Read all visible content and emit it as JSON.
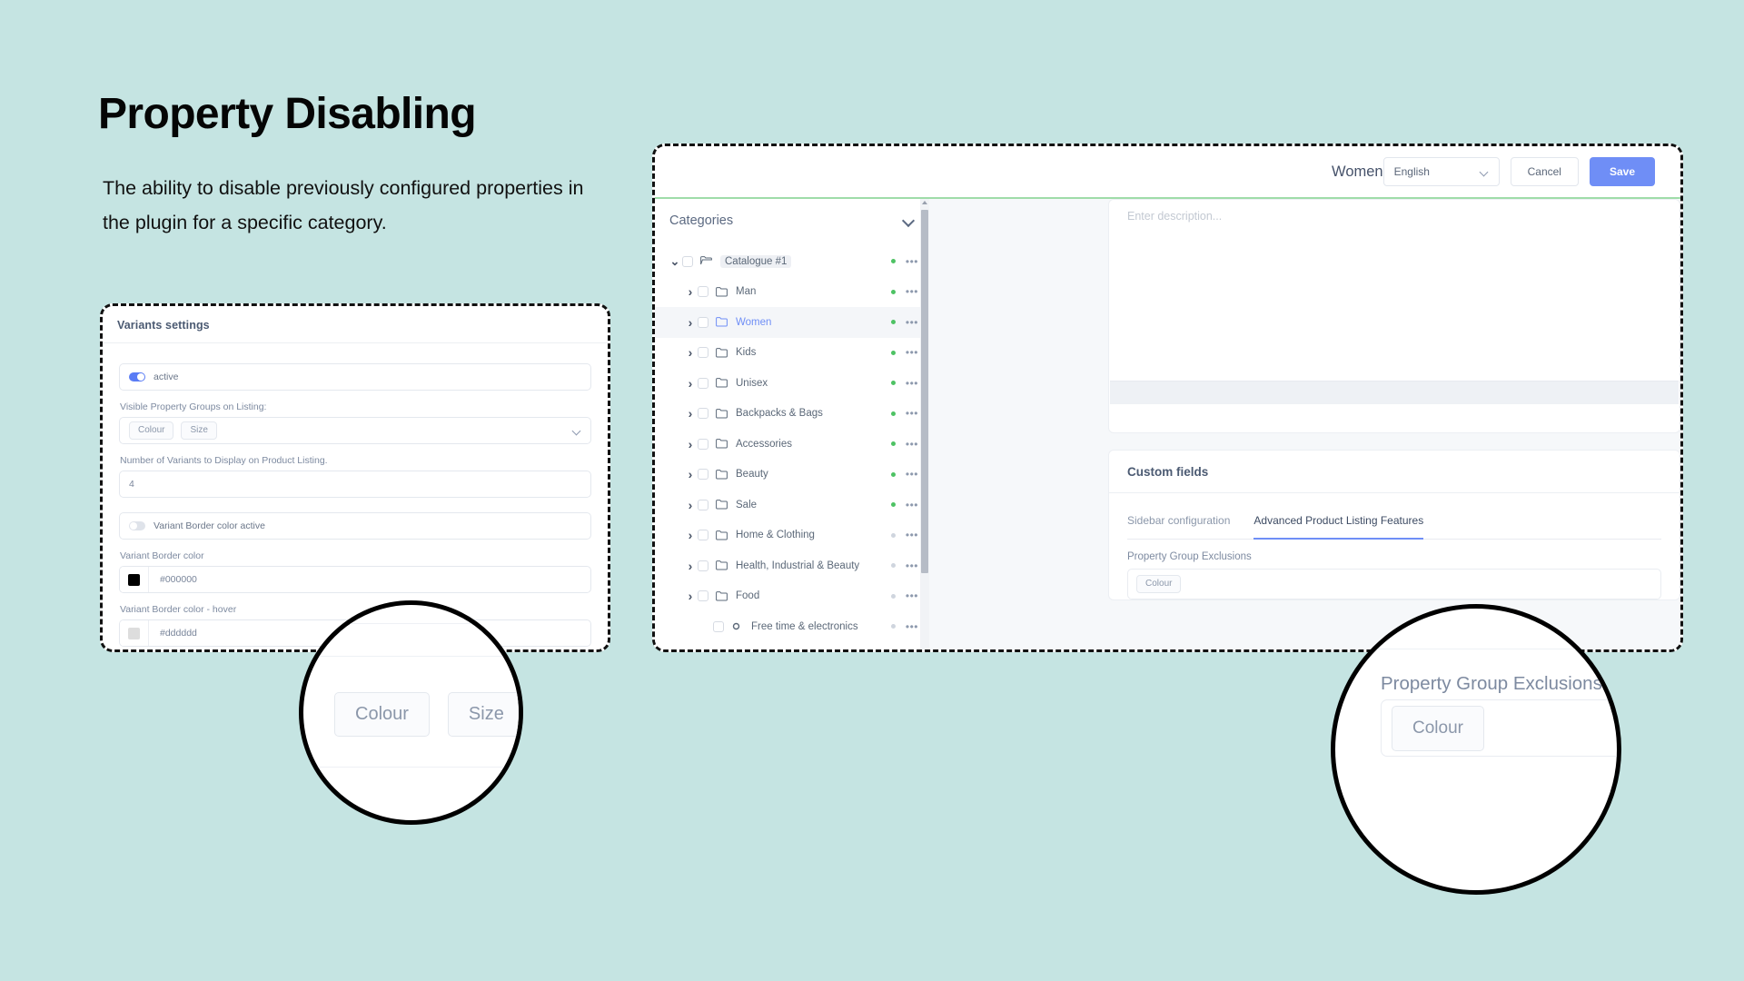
{
  "page": {
    "headline": "Property Disabling",
    "subtext": "The ability to disable previously configured properties in the plugin for a specific category.",
    "background_color": "#c5e4e2",
    "accent_color": "#6f8ef6",
    "green_rule_color": "#9fdca9"
  },
  "variants_panel": {
    "title": "Variants settings",
    "active_toggle": {
      "label": "active",
      "state": "on"
    },
    "visible_groups": {
      "label": "Visible Property Groups on Listing:",
      "pills": [
        "Colour",
        "Size"
      ],
      "chevron_icon": "chevron-down-icon"
    },
    "variant_count": {
      "label": "Number of Variants to Display on Product Listing.",
      "value": "4"
    },
    "border_toggle": {
      "label": "Variant Border color active",
      "state": "off"
    },
    "border_color": {
      "label": "Variant Border color",
      "value": "#000000",
      "swatch": "#000000"
    },
    "border_color_hover": {
      "label": "Variant Border color - hover",
      "value": "#dddddd",
      "swatch": "#dddddd"
    }
  },
  "app": {
    "title": "Women",
    "language": {
      "value": "English",
      "chevron_icon": "chevron-down-icon"
    },
    "cancel_label": "Cancel",
    "save_label": "Save",
    "tree": {
      "header": "Categories",
      "collapse_icon": "chevron-down-icon",
      "items": [
        {
          "label": "Catalogue #1",
          "indent": 0,
          "arrow": "down",
          "chip": true,
          "selected": false,
          "active": false,
          "dot": "green",
          "folder": "folder-open-icon"
        },
        {
          "label": "Man",
          "indent": 1,
          "arrow": "right",
          "chip": false,
          "selected": false,
          "active": false,
          "dot": "green",
          "folder": "folder-icon"
        },
        {
          "label": "Women",
          "indent": 1,
          "arrow": "right",
          "chip": false,
          "selected": true,
          "active": true,
          "dot": "green",
          "folder": "folder-icon"
        },
        {
          "label": "Kids",
          "indent": 1,
          "arrow": "right",
          "chip": false,
          "selected": false,
          "active": false,
          "dot": "green",
          "folder": "folder-icon"
        },
        {
          "label": "Unisex",
          "indent": 1,
          "arrow": "right",
          "chip": false,
          "selected": false,
          "active": false,
          "dot": "green",
          "folder": "folder-icon"
        },
        {
          "label": "Backpacks & Bags",
          "indent": 1,
          "arrow": "right",
          "chip": false,
          "selected": false,
          "active": false,
          "dot": "green",
          "folder": "folder-icon"
        },
        {
          "label": "Accessories",
          "indent": 1,
          "arrow": "right",
          "chip": false,
          "selected": false,
          "active": false,
          "dot": "green",
          "folder": "folder-icon"
        },
        {
          "label": "Beauty",
          "indent": 1,
          "arrow": "right",
          "chip": false,
          "selected": false,
          "active": false,
          "dot": "green",
          "folder": "folder-icon"
        },
        {
          "label": "Sale",
          "indent": 1,
          "arrow": "right",
          "chip": false,
          "selected": false,
          "active": false,
          "dot": "green",
          "folder": "folder-icon"
        },
        {
          "label": "Home & Clothing",
          "indent": 1,
          "arrow": "right",
          "chip": false,
          "selected": false,
          "active": false,
          "dot": "grey",
          "folder": "folder-icon"
        },
        {
          "label": "Health, Industrial & Beauty",
          "indent": 1,
          "arrow": "right",
          "chip": false,
          "selected": false,
          "active": false,
          "dot": "grey",
          "folder": "folder-icon"
        },
        {
          "label": "Food",
          "indent": 1,
          "arrow": "right",
          "chip": false,
          "selected": false,
          "active": false,
          "dot": "grey",
          "folder": "folder-icon"
        },
        {
          "label": "Free time & electronics",
          "indent": 2,
          "arrow": "none",
          "chip": false,
          "selected": false,
          "active": false,
          "dot": "grey",
          "folder": "circle-node-icon"
        }
      ],
      "row_menu_icon": "ellipsis-icon"
    },
    "description": {
      "placeholder": "Enter description..."
    },
    "custom_fields": {
      "title": "Custom fields",
      "tabs": [
        {
          "label": "Sidebar configuration",
          "active": false
        },
        {
          "label": "Advanced Product Listing Features",
          "active": true
        }
      ],
      "exclusions": {
        "label": "Property Group Exclusions",
        "pills": [
          "Colour"
        ]
      }
    }
  },
  "magnifiers": {
    "left": {
      "pills": [
        "Colour",
        "Size"
      ]
    },
    "right": {
      "label": "Property Group Exclusions",
      "pills": [
        "Colour"
      ]
    }
  }
}
